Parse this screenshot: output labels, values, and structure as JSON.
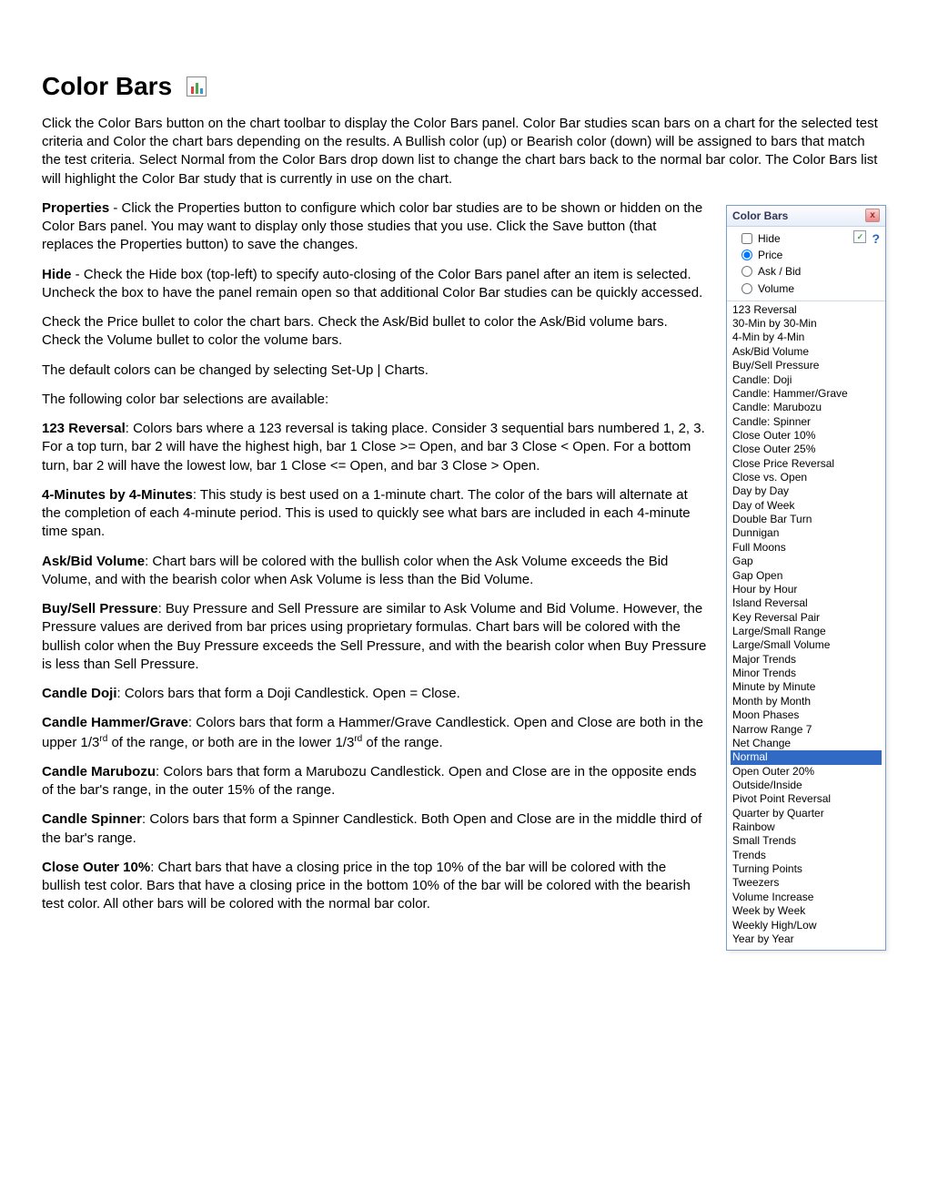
{
  "title": "Color Bars",
  "intro": "Click the  Color Bars  button on the chart toolbar to display the Color Bars panel. Color Bar studies scan bars on a chart for the selected test criteria and Color the chart bars depending on the results. A Bullish color (up) or Bearish color (down) will be assigned to bars that match the test criteria. Select Normal from the Color Bars drop down list to change the chart bars back to the normal bar color. The Color Bars list will highlight the Color Bar study that is currently in use on the chart.",
  "props_label": "Properties",
  "props_text": " - Click the  Properties  button to configure which color bar studies are to be shown or hidden on the Color Bars panel.  You may want to display only those studies that you use.  Click the Save button (that replaces the Properties button) to save the changes.",
  "hide_label": "Hide",
  "hide_text": " - Check the  Hide  box (top-left) to specify auto-closing of the Color Bars panel after an item is selected. Uncheck the box to have the panel remain open so that additional Color Bar studies can be quickly accessed.",
  "price_text": "Check the  Price  bullet to color the chart bars. Check the  Ask/Bid  bullet to color the Ask/Bid volume bars.  Check the  Volume  bullet to color the volume bars.",
  "default_colors": "The default colors can be changed by selecting Set-Up | Charts.",
  "following": "The following color bar selections are available:",
  "d123_label": "123 Reversal",
  "d123_text": ": Colors bars where a 123 reversal is taking place.  Consider 3 sequential bars numbered 1, 2, 3.   For a top turn, bar 2 will have the highest high, bar 1 Close >= Open, and bar 3 Close < Open.  For a bottom turn, bar 2 will have the lowest low, bar 1 Close <= Open, and bar 3 Close > Open.",
  "d4min_label": "4-Minutes by 4-Minutes",
  "d4min_text": ": This study is best used on a 1-minute chart. The color of the bars will alternate at the completion of each 4-minute period.  This is used to quickly see what bars are included in each 4-minute time span.",
  "askbid_label": "Ask/Bid Volume",
  "askbid_text": ": Chart bars will be colored with the bullish color when the Ask Volume exceeds the Bid Volume, and with the bearish color when Ask Volume is less than the Bid Volume.",
  "bs_label": "Buy/Sell Pressure",
  "bs_text": ": Buy Pressure and Sell Pressure are similar to Ask Volume and Bid Volume.  However, the Pressure values are derived from bar prices using proprietary formulas. Chart bars will be colored with the bullish color when the Buy Pressure exceeds the Sell Pressure, and with the bearish color when Buy Pressure is less than Sell Pressure.",
  "doji_label": "Candle Doji",
  "doji_text": ":  Colors bars that form a Doji Candlestick.  Open = Close.",
  "hammer_label": "Candle Hammer/Grave",
  "hammer_text_a": ":  Colors bars that form a Hammer/Grave Candlestick.  Open and Close are both in the upper 1/3",
  "hammer_text_b": " of the range, or both are in the lower 1/3",
  "hammer_text_c": " of the range.",
  "rd": "rd",
  "maru_label": "Candle Marubozu",
  "maru_text": ":  Colors bars that form a Marubozu Candlestick.   Open and Close are in the opposite ends of the bar's range, in the outer 15% of the range.",
  "spin_label": "Candle Spinner",
  "spin_text": ": Colors bars that form a Spinner Candlestick.  Both Open and Close are in the middle third of the bar's range.",
  "c10_label": "Close Outer 10%",
  "c10_text": ": Chart bars that have a closing price in the top 10% of the bar will be colored with the bullish test color. Bars that have a closing price in the bottom 10% of the bar will be colored with the bearish test color. All other bars will be colored with the normal bar color.",
  "panel": {
    "title": "Color Bars",
    "hide": "Hide",
    "price": "Price",
    "askbid": "Ask / Bid",
    "volume": "Volume",
    "selected": "Normal",
    "items": [
      "123 Reversal",
      "30-Min by 30-Min",
      "4-Min by 4-Min",
      "Ask/Bid Volume",
      "Buy/Sell Pressure",
      "Candle: Doji",
      "Candle: Hammer/Grave",
      "Candle: Marubozu",
      "Candle: Spinner",
      "Close Outer 10%",
      "Close Outer 25%",
      "Close Price Reversal",
      "Close vs. Open",
      "Day by Day",
      "Day of Week",
      "Double Bar Turn",
      "Dunnigan",
      "Full Moons",
      "Gap",
      "Gap Open",
      "Hour by Hour",
      "Island Reversal",
      "Key Reversal Pair",
      "Large/Small Range",
      "Large/Small Volume",
      "Major Trends",
      "Minor Trends",
      "Minute by Minute",
      "Month by Month",
      "Moon Phases",
      "Narrow Range 7",
      "Net Change",
      "Normal",
      "Open Outer 20%",
      "Outside/Inside",
      "Pivot Point Reversal",
      "Quarter by Quarter",
      "Rainbow",
      "Small Trends",
      "Trends",
      "Turning Points",
      "Tweezers",
      "Volume Increase",
      "Week by Week",
      "Weekly High/Low",
      "Year by Year"
    ]
  }
}
